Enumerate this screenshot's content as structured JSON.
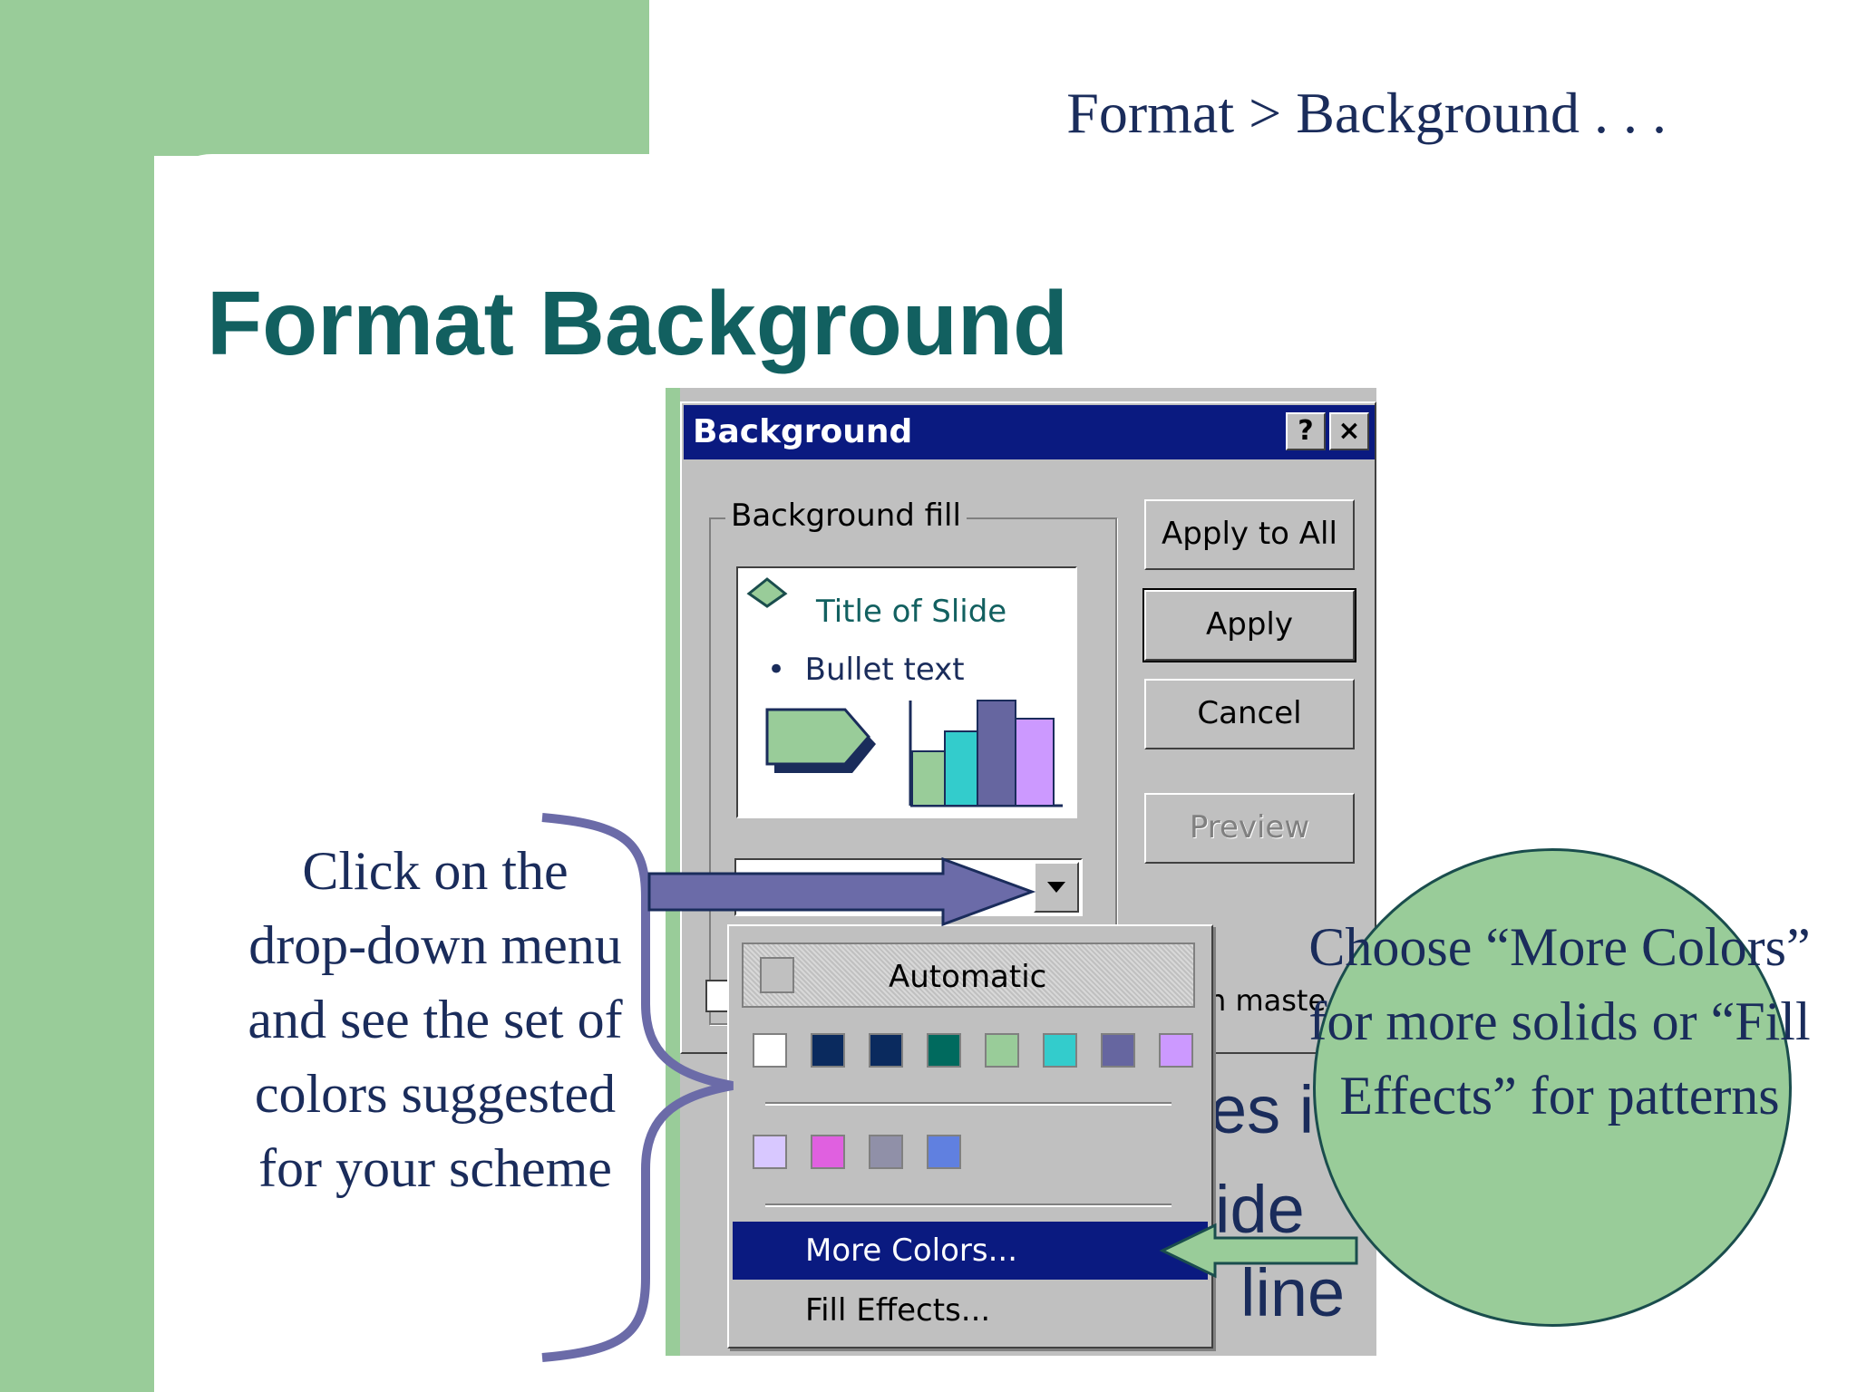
{
  "slide": {
    "subtitle": "Format > Background . . .",
    "title": "Format Background",
    "callout_left": "Click on the drop-down menu and see the set of colors suggested for your scheme",
    "callout_right": "Choose “More Colors” for more solids or “Fill Effects” for patterns",
    "behind_text": [
      "es i",
      "ide",
      "line"
    ]
  },
  "dialog": {
    "title": "Background",
    "help_label": "?",
    "close_label": "×",
    "group_label": "Background fill",
    "preview": {
      "title": "Title of Slide",
      "bullet": "Bullet text"
    },
    "buttons": {
      "apply_all": "Apply to All",
      "apply": "Apply",
      "cancel": "Cancel",
      "preview": "Preview"
    },
    "master_text": "n maste"
  },
  "dropdown": {
    "automatic": "Automatic",
    "scheme_colors": [
      "#ffffff",
      "#0a2a5e",
      "#0a2a5e",
      "#006a5e",
      "#99cc99",
      "#33cccc",
      "#6666a0",
      "#cc99ff"
    ],
    "extra_colors": [
      "#d8c8ff",
      "#e060e0",
      "#9090a8",
      "#6080e0"
    ],
    "more_colors": "More Colors...",
    "fill_effects": "Fill Effects..."
  },
  "colors": {
    "slide_green": "#99cc99",
    "title_teal": "#126060",
    "text_navy": "#1a2c5b",
    "brace_purple": "#6b6ba8",
    "dialog_titlebar": "#0a1a80"
  }
}
